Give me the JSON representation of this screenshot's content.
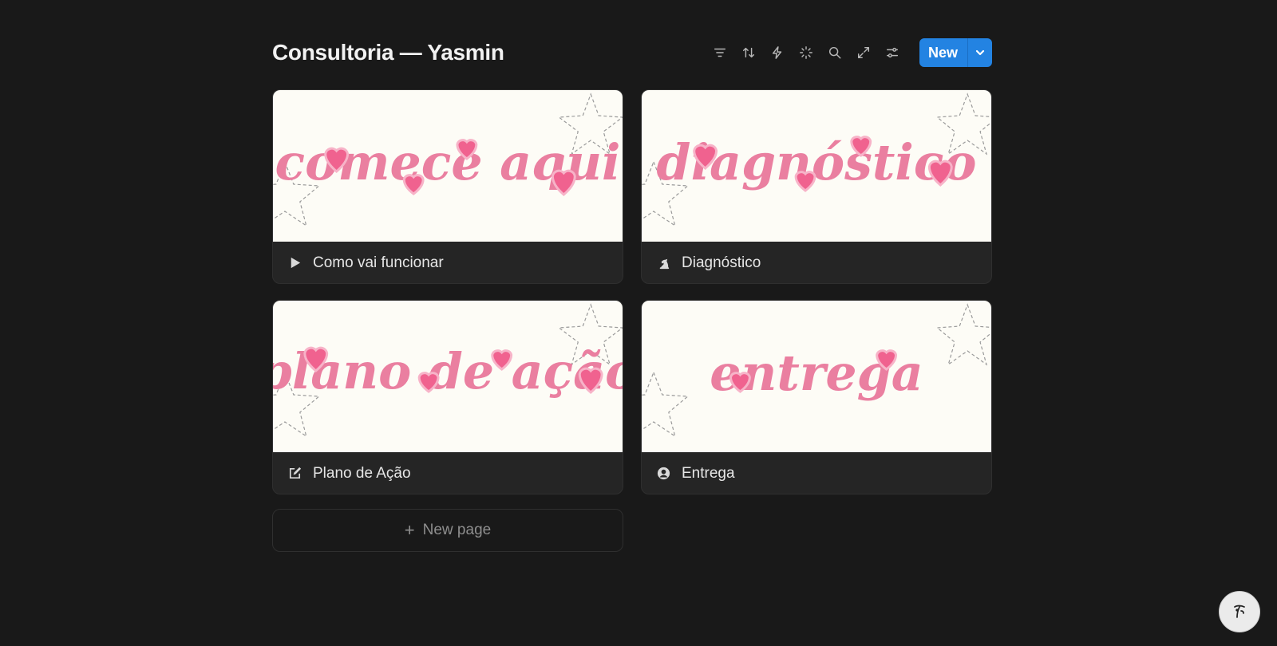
{
  "header": {
    "title": "Consultoria — Yasmin",
    "new_label": "New"
  },
  "toolbar": {
    "icons": [
      "filter-icon",
      "sort-icon",
      "automation-icon",
      "ai-sparkle-icon",
      "search-icon",
      "expand-icon",
      "settings-sliders-icon"
    ]
  },
  "cards": [
    {
      "cover_text": "comece aqui",
      "title": "Como vai funcionar",
      "icon": "play-icon"
    },
    {
      "cover_text": "diagnóstico",
      "title": "Diagnóstico",
      "icon": "chess-knight-icon"
    },
    {
      "cover_text": "plano de ação",
      "title": "Plano de Ação",
      "icon": "edit-icon"
    },
    {
      "cover_text": "entrega",
      "title": "Entrega",
      "icon": "user-circle-icon"
    }
  ],
  "new_page": {
    "label": "New page"
  },
  "colors": {
    "background": "#191919",
    "card": "#252525",
    "cover": "#fdfcf6",
    "cover_text": "#ea7fa0",
    "heart": "#f0628f",
    "accent": "#2383e2"
  },
  "help_button": {
    "icon": "help-face-icon"
  }
}
